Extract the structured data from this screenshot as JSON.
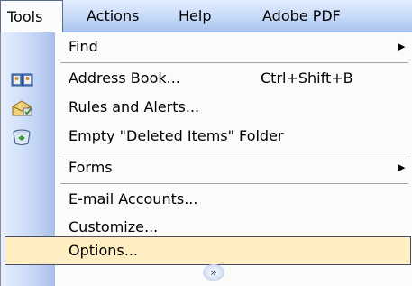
{
  "menubar": {
    "tools": "Tools",
    "actions": "Actions",
    "help": "Help",
    "adobe_pdf": "Adobe PDF"
  },
  "menu": {
    "find": "Find",
    "address_book": "Address Book...",
    "address_book_shortcut": "Ctrl+Shift+B",
    "rules_alerts": "Rules and Alerts...",
    "empty_deleted": "Empty \"Deleted Items\" Folder",
    "forms": "Forms",
    "email_accounts": "E-mail Accounts...",
    "customize": "Customize...",
    "options": "Options...",
    "submenu_arrow": "▶",
    "expand_glyph": "»"
  },
  "colors": {
    "menubar_gradient": [
      "#e3edff",
      "#a9c3ee"
    ],
    "gutter_gradient": [
      "#e6efff",
      "#a7bfea"
    ],
    "highlight": "#ffeec2",
    "highlight_border": "#4b4b6f"
  },
  "icons": {
    "address_book": "address-book-icon",
    "rules_alerts": "rules-alerts-icon",
    "empty_deleted": "recycle-bin-icon"
  }
}
